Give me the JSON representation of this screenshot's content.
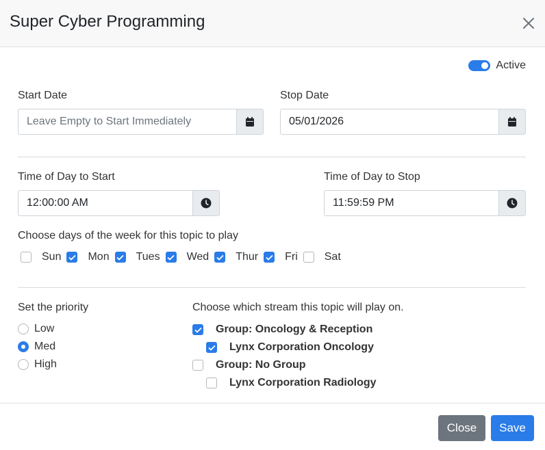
{
  "dialog": {
    "title": "Super Cyber Programming"
  },
  "active_toggle": {
    "label": "Active",
    "on": true
  },
  "start_date": {
    "label": "Start Date",
    "value": "",
    "placeholder": "Leave Empty to Start Immediately"
  },
  "stop_date": {
    "label": "Stop Date",
    "value": "05/01/2026",
    "placeholder": ""
  },
  "time_start": {
    "label": "Time of Day to Start",
    "value": "12:00:00 AM"
  },
  "time_stop": {
    "label": "Time of Day to Stop",
    "value": "11:59:59 PM"
  },
  "days": {
    "label": "Choose days of the week for this topic to play",
    "items": [
      {
        "label": "Sun",
        "checked": false
      },
      {
        "label": "Mon",
        "checked": true
      },
      {
        "label": "Tues",
        "checked": true
      },
      {
        "label": "Wed",
        "checked": true
      },
      {
        "label": "Thur",
        "checked": true
      },
      {
        "label": "Fri",
        "checked": true
      },
      {
        "label": "Sat",
        "checked": false
      }
    ]
  },
  "priority": {
    "label": "Set the priority",
    "options": [
      {
        "label": "Low",
        "checked": false
      },
      {
        "label": "Med",
        "checked": true
      },
      {
        "label": "High",
        "checked": false
      }
    ]
  },
  "streams": {
    "label": "Choose which stream this topic will play on.",
    "items": [
      {
        "label": "Group: Oncology & Reception",
        "checked": true
      },
      {
        "label": "Lynx Corporation Oncology",
        "checked": true
      },
      {
        "label": "Group: No Group",
        "checked": false
      },
      {
        "label": "Lynx Corporation Radiology",
        "checked": false
      }
    ]
  },
  "footer": {
    "close_label": "Close",
    "save_label": "Save"
  },
  "colors": {
    "accent": "#2a7ce8",
    "secondary": "#6c757d",
    "addon_bg": "#e9ecef"
  },
  "icons": {
    "close": "close-icon",
    "calendar": "calendar-icon",
    "clock": "clock-icon",
    "check": "check-icon"
  }
}
